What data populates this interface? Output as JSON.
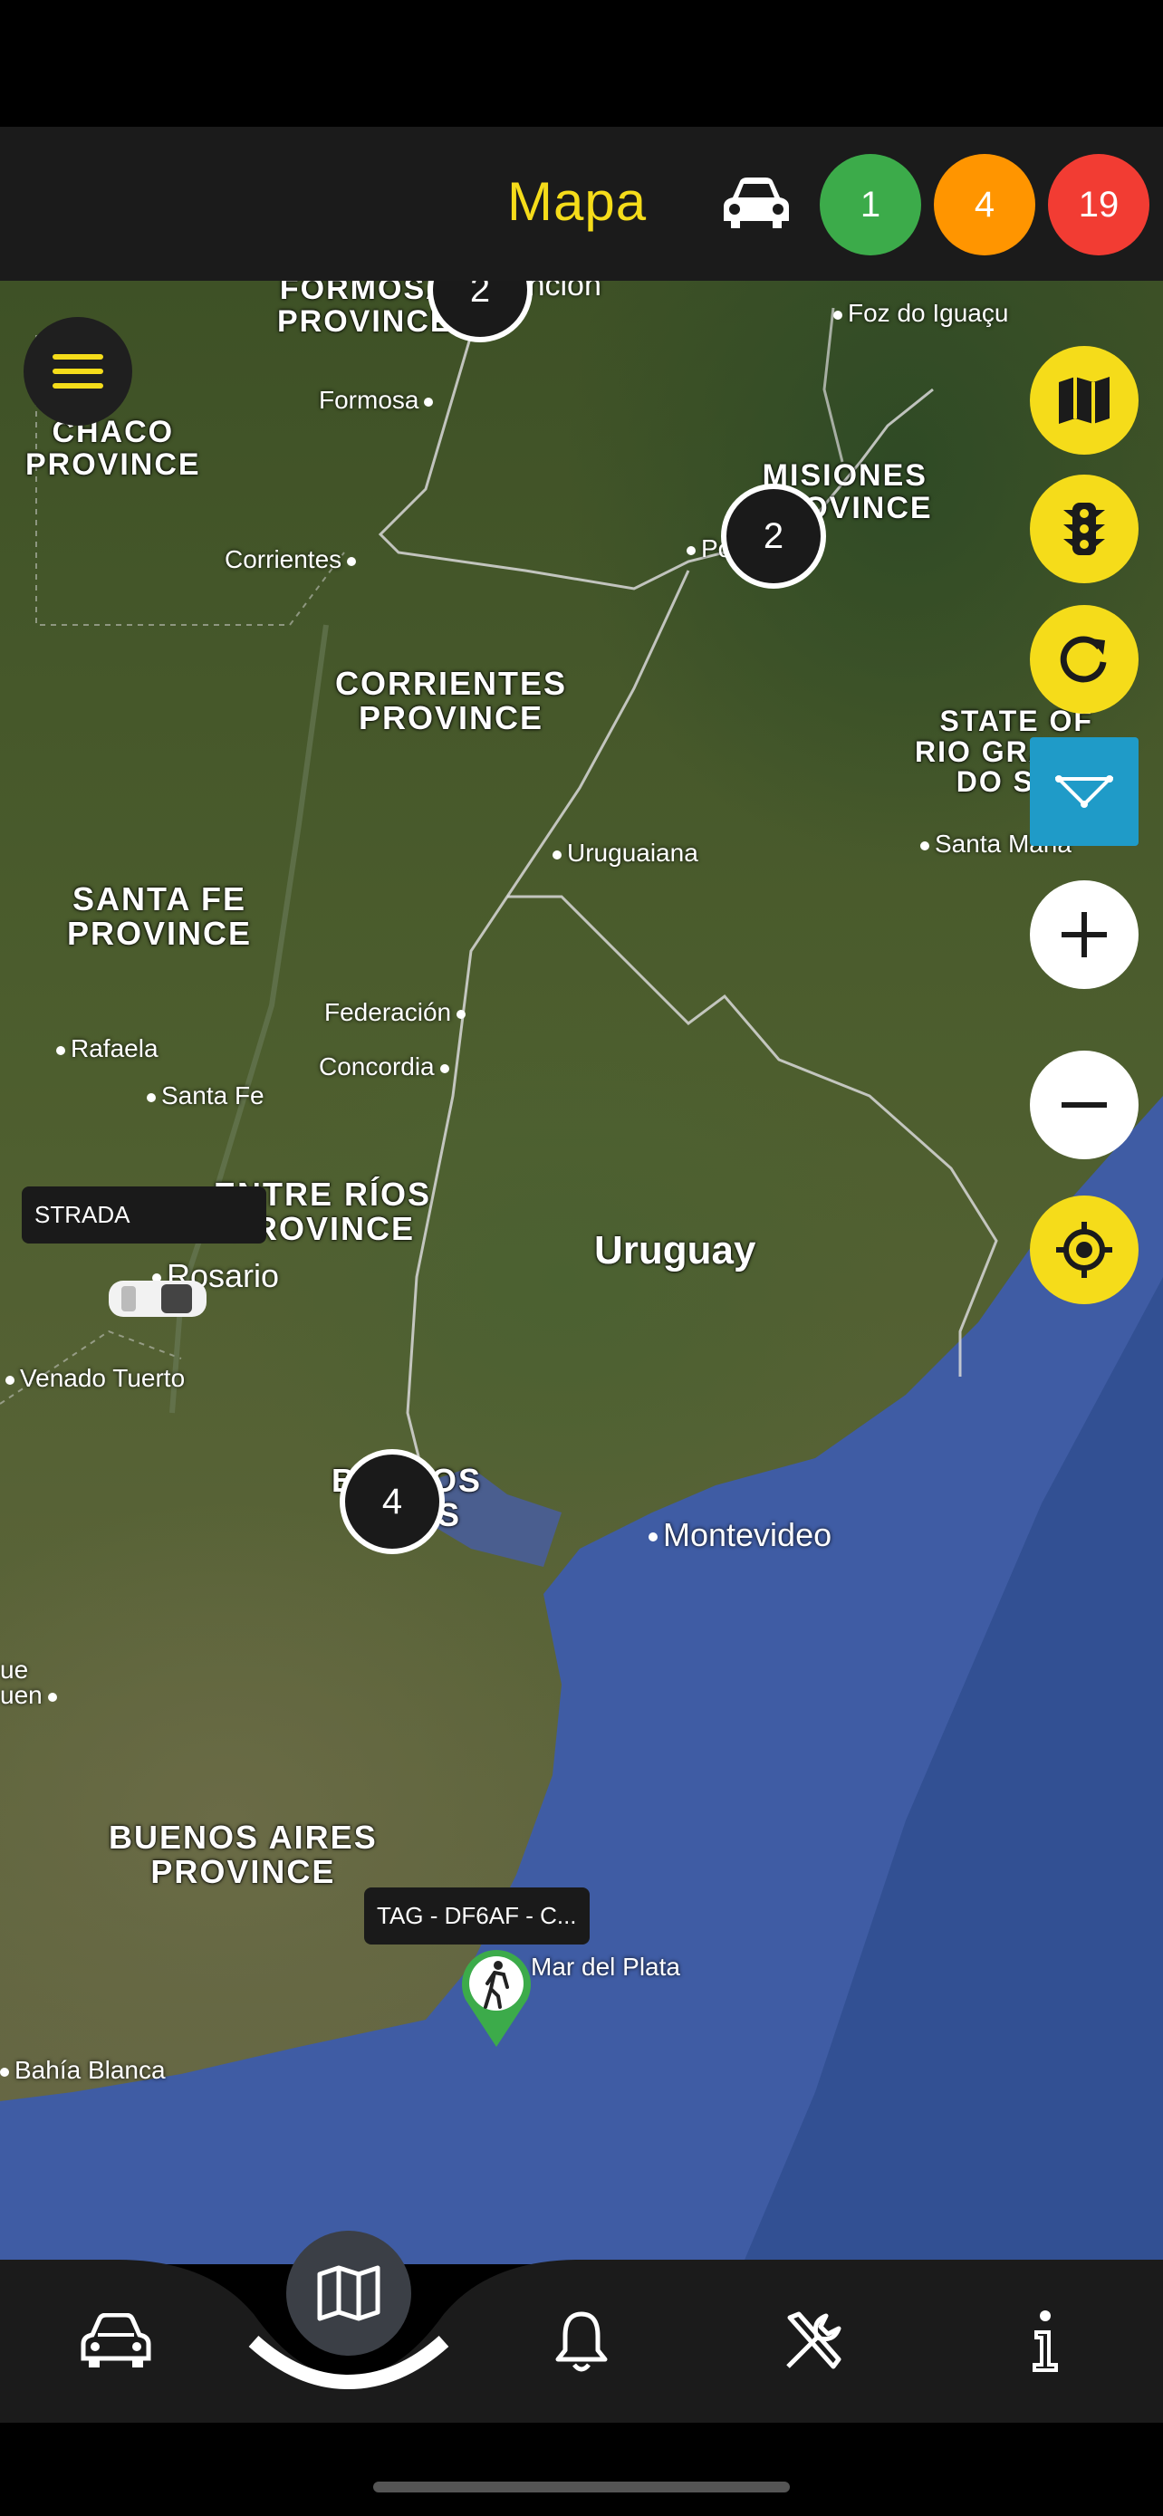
{
  "header": {
    "title": "Mapa",
    "badges": {
      "green": "1",
      "orange": "4",
      "red": "19"
    }
  },
  "map": {
    "labels": {
      "formosa_province": "FORMOSA\nPROVINCE",
      "chaco": "CHACO\nPROVINCE",
      "misiones": "MISIONES\nPROVINCE",
      "corrientes_prov": "CORRIENTES\nPROVINCE",
      "rio_grande": "STATE OF\nRIO GRANDE\nDO SUL",
      "santa_fe_prov": "SANTA FE\nPROVINCE",
      "entre_rios": "ENTRE RÍOS\nPROVINCE",
      "uruguay": "Uruguay",
      "buenos_aires_prov": "BUENOS AIRES\nPROVINCE",
      "buenos_aires_city": "BUENOS\nAIRES"
    },
    "cities": {
      "asuncion": "Asunción",
      "foz": "Foz do Iguaçu",
      "formosa": "Formosa",
      "corrientes": "Corrientes",
      "posadas": "Posadas",
      "uruguaiana": "Uruguaiana",
      "santa_maria": "Santa Maria",
      "federacion": "Federación",
      "concordia": "Concordia",
      "rafaela": "Rafaela",
      "santa_fe": "Santa Fe",
      "rosario": "Rosario",
      "venado_tuerto": "Venado Tuerto",
      "montevideo": "Montevideo",
      "mar_del_plata": "Mar del Plata",
      "bahia_blanca": "Bahía Blanca",
      "pehuajo": "ue\nuen"
    },
    "clusters": {
      "top": "2",
      "misiones": "2",
      "buenos_aires": "4"
    },
    "markers": {
      "strada_label": "STRADA",
      "tag_label": "TAG - DF6AF - C..."
    }
  },
  "icons": {
    "menu": "hamburger-icon",
    "map_type": "map-icon",
    "traffic": "traffic-light-icon",
    "refresh": "refresh-icon",
    "route": "route-icon",
    "zoom_in": "plus-icon",
    "zoom_out": "minus-icon",
    "locate": "crosshair-icon"
  },
  "colors": {
    "accent_yellow": "#f5dc1a",
    "green": "#3cab4a",
    "orange": "#ff9500",
    "red": "#f23c33",
    "route_blue": "#1f9bc8"
  }
}
